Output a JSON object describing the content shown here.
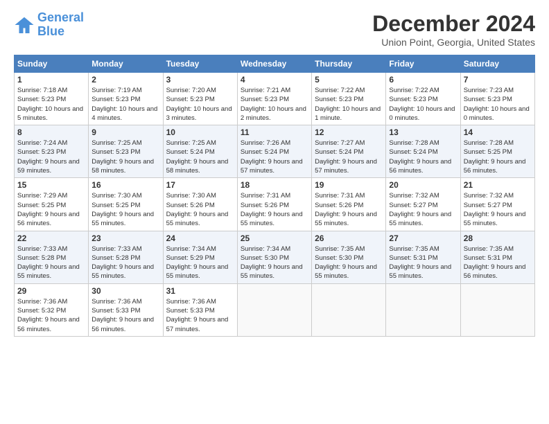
{
  "header": {
    "logo_line1": "General",
    "logo_line2": "Blue",
    "title": "December 2024",
    "subtitle": "Union Point, Georgia, United States"
  },
  "weekdays": [
    "Sunday",
    "Monday",
    "Tuesday",
    "Wednesday",
    "Thursday",
    "Friday",
    "Saturday"
  ],
  "weeks": [
    [
      {
        "day": "1",
        "sunrise": "Sunrise: 7:18 AM",
        "sunset": "Sunset: 5:23 PM",
        "daylight": "Daylight: 10 hours and 5 minutes."
      },
      {
        "day": "2",
        "sunrise": "Sunrise: 7:19 AM",
        "sunset": "Sunset: 5:23 PM",
        "daylight": "Daylight: 10 hours and 4 minutes."
      },
      {
        "day": "3",
        "sunrise": "Sunrise: 7:20 AM",
        "sunset": "Sunset: 5:23 PM",
        "daylight": "Daylight: 10 hours and 3 minutes."
      },
      {
        "day": "4",
        "sunrise": "Sunrise: 7:21 AM",
        "sunset": "Sunset: 5:23 PM",
        "daylight": "Daylight: 10 hours and 2 minutes."
      },
      {
        "day": "5",
        "sunrise": "Sunrise: 7:22 AM",
        "sunset": "Sunset: 5:23 PM",
        "daylight": "Daylight: 10 hours and 1 minute."
      },
      {
        "day": "6",
        "sunrise": "Sunrise: 7:22 AM",
        "sunset": "Sunset: 5:23 PM",
        "daylight": "Daylight: 10 hours and 0 minutes."
      },
      {
        "day": "7",
        "sunrise": "Sunrise: 7:23 AM",
        "sunset": "Sunset: 5:23 PM",
        "daylight": "Daylight: 10 hours and 0 minutes."
      }
    ],
    [
      {
        "day": "8",
        "sunrise": "Sunrise: 7:24 AM",
        "sunset": "Sunset: 5:23 PM",
        "daylight": "Daylight: 9 hours and 59 minutes."
      },
      {
        "day": "9",
        "sunrise": "Sunrise: 7:25 AM",
        "sunset": "Sunset: 5:23 PM",
        "daylight": "Daylight: 9 hours and 58 minutes."
      },
      {
        "day": "10",
        "sunrise": "Sunrise: 7:25 AM",
        "sunset": "Sunset: 5:24 PM",
        "daylight": "Daylight: 9 hours and 58 minutes."
      },
      {
        "day": "11",
        "sunrise": "Sunrise: 7:26 AM",
        "sunset": "Sunset: 5:24 PM",
        "daylight": "Daylight: 9 hours and 57 minutes."
      },
      {
        "day": "12",
        "sunrise": "Sunrise: 7:27 AM",
        "sunset": "Sunset: 5:24 PM",
        "daylight": "Daylight: 9 hours and 57 minutes."
      },
      {
        "day": "13",
        "sunrise": "Sunrise: 7:28 AM",
        "sunset": "Sunset: 5:24 PM",
        "daylight": "Daylight: 9 hours and 56 minutes."
      },
      {
        "day": "14",
        "sunrise": "Sunrise: 7:28 AM",
        "sunset": "Sunset: 5:25 PM",
        "daylight": "Daylight: 9 hours and 56 minutes."
      }
    ],
    [
      {
        "day": "15",
        "sunrise": "Sunrise: 7:29 AM",
        "sunset": "Sunset: 5:25 PM",
        "daylight": "Daylight: 9 hours and 56 minutes."
      },
      {
        "day": "16",
        "sunrise": "Sunrise: 7:30 AM",
        "sunset": "Sunset: 5:25 PM",
        "daylight": "Daylight: 9 hours and 55 minutes."
      },
      {
        "day": "17",
        "sunrise": "Sunrise: 7:30 AM",
        "sunset": "Sunset: 5:26 PM",
        "daylight": "Daylight: 9 hours and 55 minutes."
      },
      {
        "day": "18",
        "sunrise": "Sunrise: 7:31 AM",
        "sunset": "Sunset: 5:26 PM",
        "daylight": "Daylight: 9 hours and 55 minutes."
      },
      {
        "day": "19",
        "sunrise": "Sunrise: 7:31 AM",
        "sunset": "Sunset: 5:26 PM",
        "daylight": "Daylight: 9 hours and 55 minutes."
      },
      {
        "day": "20",
        "sunrise": "Sunrise: 7:32 AM",
        "sunset": "Sunset: 5:27 PM",
        "daylight": "Daylight: 9 hours and 55 minutes."
      },
      {
        "day": "21",
        "sunrise": "Sunrise: 7:32 AM",
        "sunset": "Sunset: 5:27 PM",
        "daylight": "Daylight: 9 hours and 55 minutes."
      }
    ],
    [
      {
        "day": "22",
        "sunrise": "Sunrise: 7:33 AM",
        "sunset": "Sunset: 5:28 PM",
        "daylight": "Daylight: 9 hours and 55 minutes."
      },
      {
        "day": "23",
        "sunrise": "Sunrise: 7:33 AM",
        "sunset": "Sunset: 5:28 PM",
        "daylight": "Daylight: 9 hours and 55 minutes."
      },
      {
        "day": "24",
        "sunrise": "Sunrise: 7:34 AM",
        "sunset": "Sunset: 5:29 PM",
        "daylight": "Daylight: 9 hours and 55 minutes."
      },
      {
        "day": "25",
        "sunrise": "Sunrise: 7:34 AM",
        "sunset": "Sunset: 5:30 PM",
        "daylight": "Daylight: 9 hours and 55 minutes."
      },
      {
        "day": "26",
        "sunrise": "Sunrise: 7:35 AM",
        "sunset": "Sunset: 5:30 PM",
        "daylight": "Daylight: 9 hours and 55 minutes."
      },
      {
        "day": "27",
        "sunrise": "Sunrise: 7:35 AM",
        "sunset": "Sunset: 5:31 PM",
        "daylight": "Daylight: 9 hours and 55 minutes."
      },
      {
        "day": "28",
        "sunrise": "Sunrise: 7:35 AM",
        "sunset": "Sunset: 5:31 PM",
        "daylight": "Daylight: 9 hours and 56 minutes."
      }
    ],
    [
      {
        "day": "29",
        "sunrise": "Sunrise: 7:36 AM",
        "sunset": "Sunset: 5:32 PM",
        "daylight": "Daylight: 9 hours and 56 minutes."
      },
      {
        "day": "30",
        "sunrise": "Sunrise: 7:36 AM",
        "sunset": "Sunset: 5:33 PM",
        "daylight": "Daylight: 9 hours and 56 minutes."
      },
      {
        "day": "31",
        "sunrise": "Sunrise: 7:36 AM",
        "sunset": "Sunset: 5:33 PM",
        "daylight": "Daylight: 9 hours and 57 minutes."
      },
      null,
      null,
      null,
      null
    ]
  ]
}
